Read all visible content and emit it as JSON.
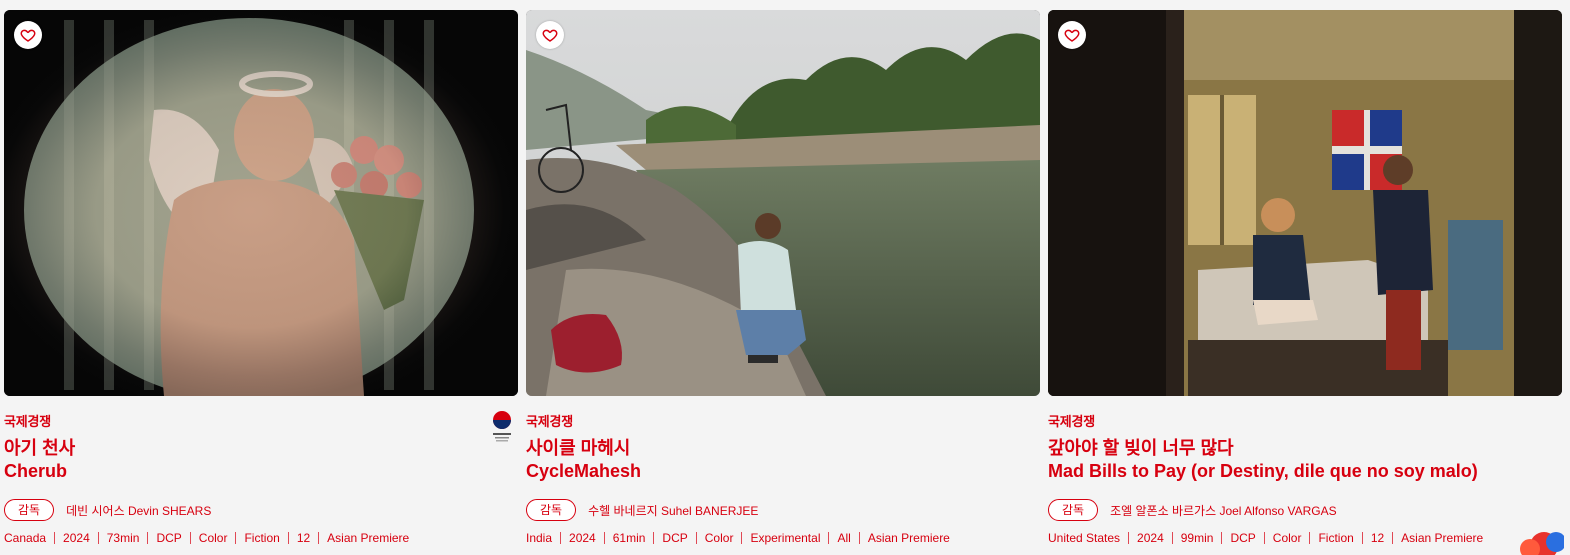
{
  "films": [
    {
      "section": "국제경쟁",
      "title_ko": "아기 천사",
      "title_en": "Cherub",
      "director_label": "감독",
      "director": "데빈 시어스 Devin SHEARS",
      "meta": [
        "Canada",
        "2024",
        "73min",
        "DCP",
        "Color",
        "Fiction",
        "12",
        "Asian Premiere"
      ],
      "favorite_icon": "heart-outline-icon"
    },
    {
      "section": "국제경쟁",
      "title_ko": "사이클 마헤시",
      "title_en": "CycleMahesh",
      "director_label": "감독",
      "director": "수헬 바네르지 Suhel BANERJEE",
      "meta": [
        "India",
        "2024",
        "61min",
        "DCP",
        "Color",
        "Experimental",
        "All",
        "Asian Premiere"
      ],
      "favorite_icon": "heart-outline-icon"
    },
    {
      "section": "국제경쟁",
      "title_ko": "갚아야 할 빚이 너무 많다",
      "title_en": "Mad Bills to Pay (or Destiny, dile que no soy malo)",
      "director_label": "감독",
      "director": "조엘 알폰소 바르가스 Joel Alfonso VARGAS",
      "meta": [
        "United States",
        "2024",
        "99min",
        "DCP",
        "Color",
        "Fiction",
        "12",
        "Asian Premiere"
      ],
      "favorite_icon": "heart-outline-icon"
    }
  ],
  "colors": {
    "accent": "#d7000f",
    "background": "#f4f4f4"
  }
}
